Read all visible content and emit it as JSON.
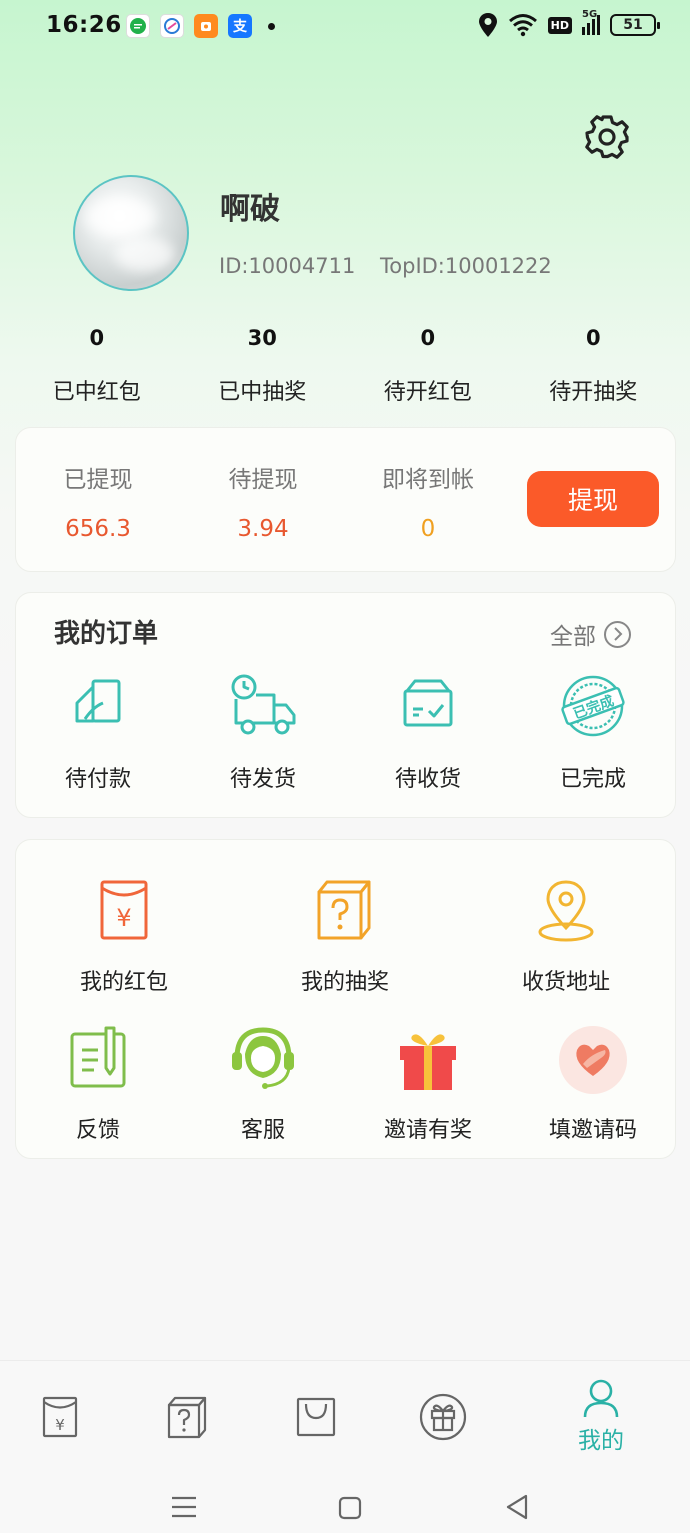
{
  "status_bar": {
    "time": "16:26",
    "network": "5G",
    "hd_label": "HD",
    "battery": "51"
  },
  "profile": {
    "username": "啊破",
    "id_text": "ID:10004711",
    "top_id_text": "TopID:10001222"
  },
  "stats": [
    {
      "value": "0",
      "label": "已中红包"
    },
    {
      "value": "30",
      "label": "已中抽奖"
    },
    {
      "value": "0",
      "label": "待开红包"
    },
    {
      "value": "0",
      "label": "待开抽奖"
    }
  ],
  "withdraw": {
    "items": [
      {
        "label": "已提现",
        "value": "656.3"
      },
      {
        "label": "待提现",
        "value": "3.94"
      },
      {
        "label": "即将到帐",
        "value": "0"
      }
    ],
    "button_label": "提现"
  },
  "orders": {
    "title": "我的订单",
    "all_label": "全部",
    "items": [
      {
        "label": "待付款",
        "icon": "wallet-icon"
      },
      {
        "label": "待发货",
        "icon": "delivery-truck-icon"
      },
      {
        "label": "待收货",
        "icon": "package-box-icon"
      },
      {
        "label": "已完成",
        "icon": "completed-stamp-icon"
      }
    ],
    "stamp_text": "已完成"
  },
  "services": [
    {
      "label": "我的红包",
      "icon": "red-envelope-icon"
    },
    {
      "label": "我的抽奖",
      "icon": "mystery-box-icon"
    },
    {
      "label": "收货地址",
      "icon": "location-pin-icon"
    },
    {
      "label": "反馈",
      "icon": "feedback-icon"
    },
    {
      "label": "客服",
      "icon": "customer-service-icon"
    },
    {
      "label": "邀请有奖",
      "icon": "gift-icon"
    },
    {
      "label": "填邀请码",
      "icon": "heart-hand-icon"
    }
  ],
  "bottom_nav": {
    "active_label": "我的",
    "tabs": [
      "red-envelope-tab-icon",
      "mystery-box-tab-icon",
      "shopping-bag-tab-icon",
      "gift-tab-icon",
      "profile-tab-icon"
    ]
  },
  "colors": {
    "accent_orange": "#fb5a29",
    "accent_teal": "#2ab1a6",
    "value_red": "#e8582f",
    "value_yellow": "#f0a020"
  }
}
